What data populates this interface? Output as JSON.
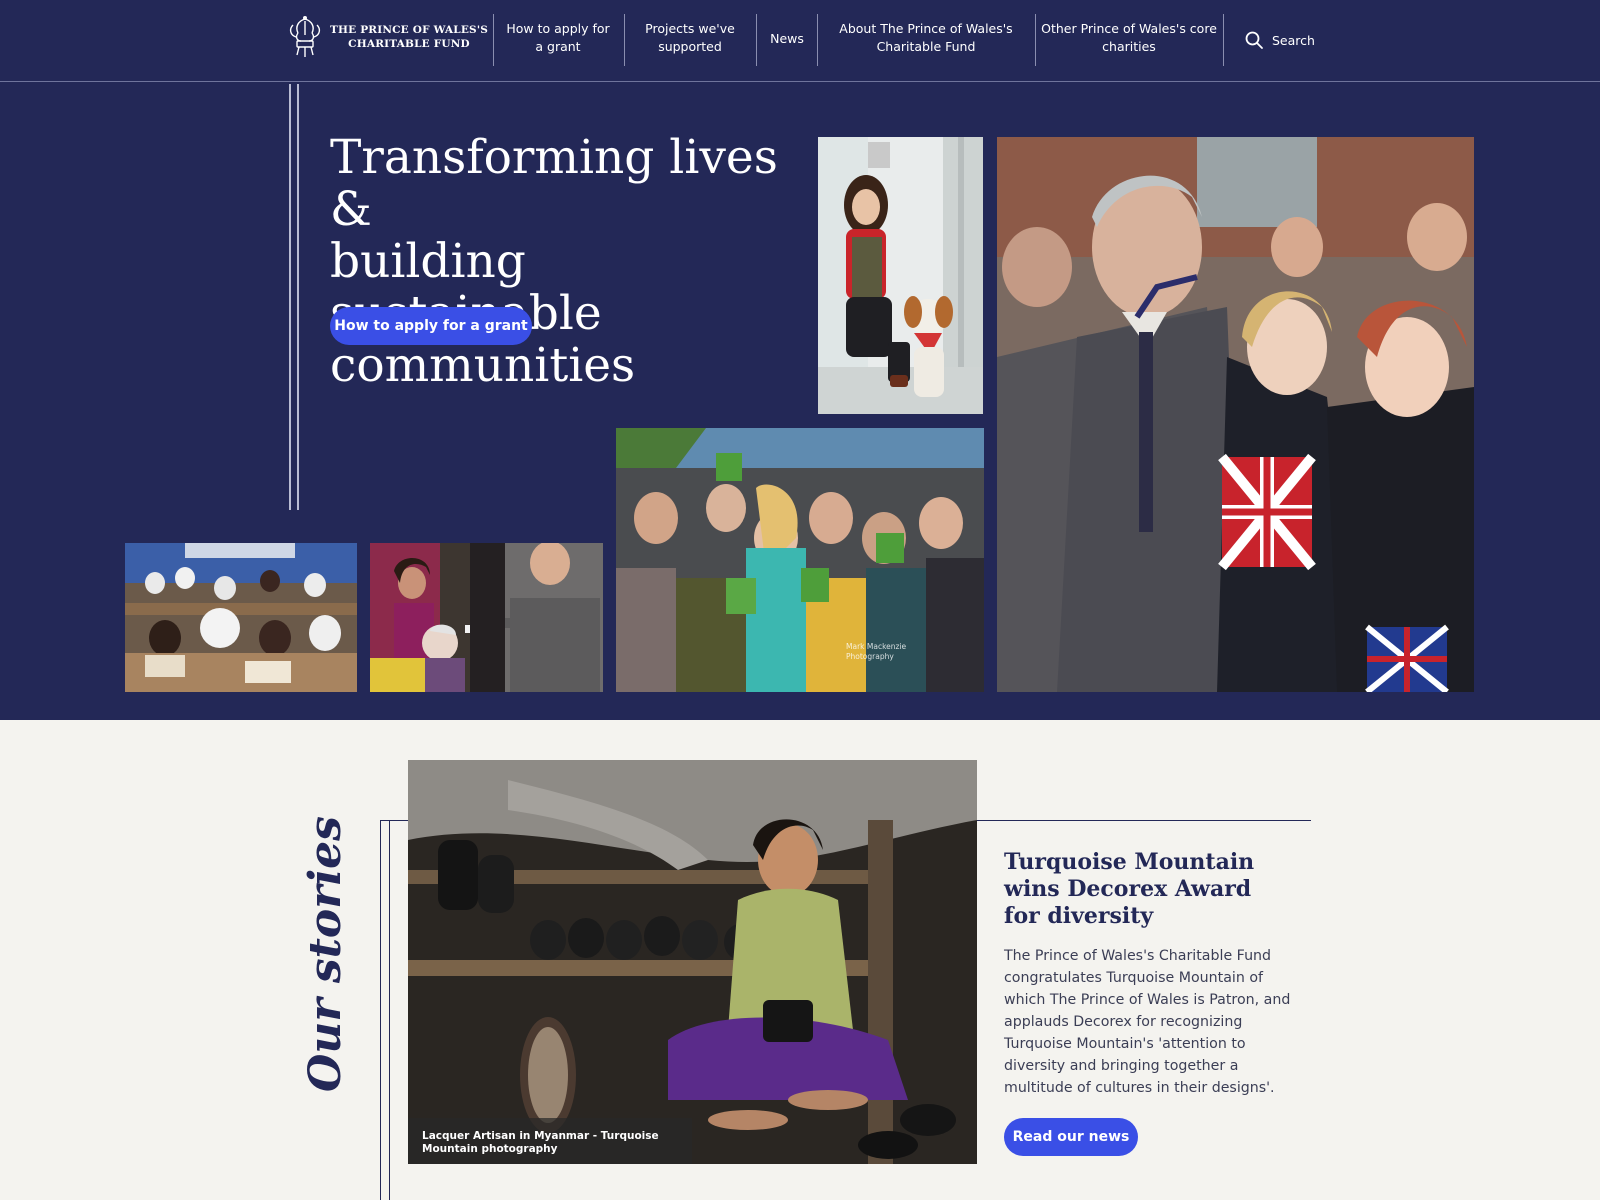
{
  "header": {
    "logo_line1": "THE PRINCE OF WALES'S",
    "logo_line2": "CHARITABLE FUND",
    "nav": [
      {
        "line1": "How to apply for",
        "line2": "a grant"
      },
      {
        "line1": "Projects we've",
        "line2": "supported"
      },
      {
        "line1": "News",
        "line2": ""
      },
      {
        "line1": "About The Prince of Wales's",
        "line2": "Charitable Fund"
      },
      {
        "line1": "Other Prince of Wales's core",
        "line2": "charities"
      }
    ],
    "search_label": "Search"
  },
  "hero": {
    "title_line1": "Transforming lives &",
    "title_line2": "building sustainable",
    "title_line3": "communities",
    "cta_label": "How to apply for a grant",
    "photo_credit_line1": "Mark Mackenzie",
    "photo_credit_line2": "Photography"
  },
  "stories": {
    "heading": "Our stories",
    "photo_caption": "Lacquer Artisan in Myanmar - Turquoise Mountain photography",
    "title": "Turquoise Mountain wins Decorex Award for diversity",
    "body": "The Prince of Wales's Charitable Fund congratulates Turquoise Mountain of which The Prince of Wales is Patron, and applauds Decorex for recognizing Turquoise Mountain's 'attention to diversity and bringing together a multitude of cultures in their designs'.",
    "cta_label": "Read our news"
  },
  "colors": {
    "navy": "#232857",
    "accent_blue": "#3a4fe6",
    "page_bg": "#f4f3ef"
  },
  "icons": [
    "crest-icon",
    "search-icon"
  ]
}
